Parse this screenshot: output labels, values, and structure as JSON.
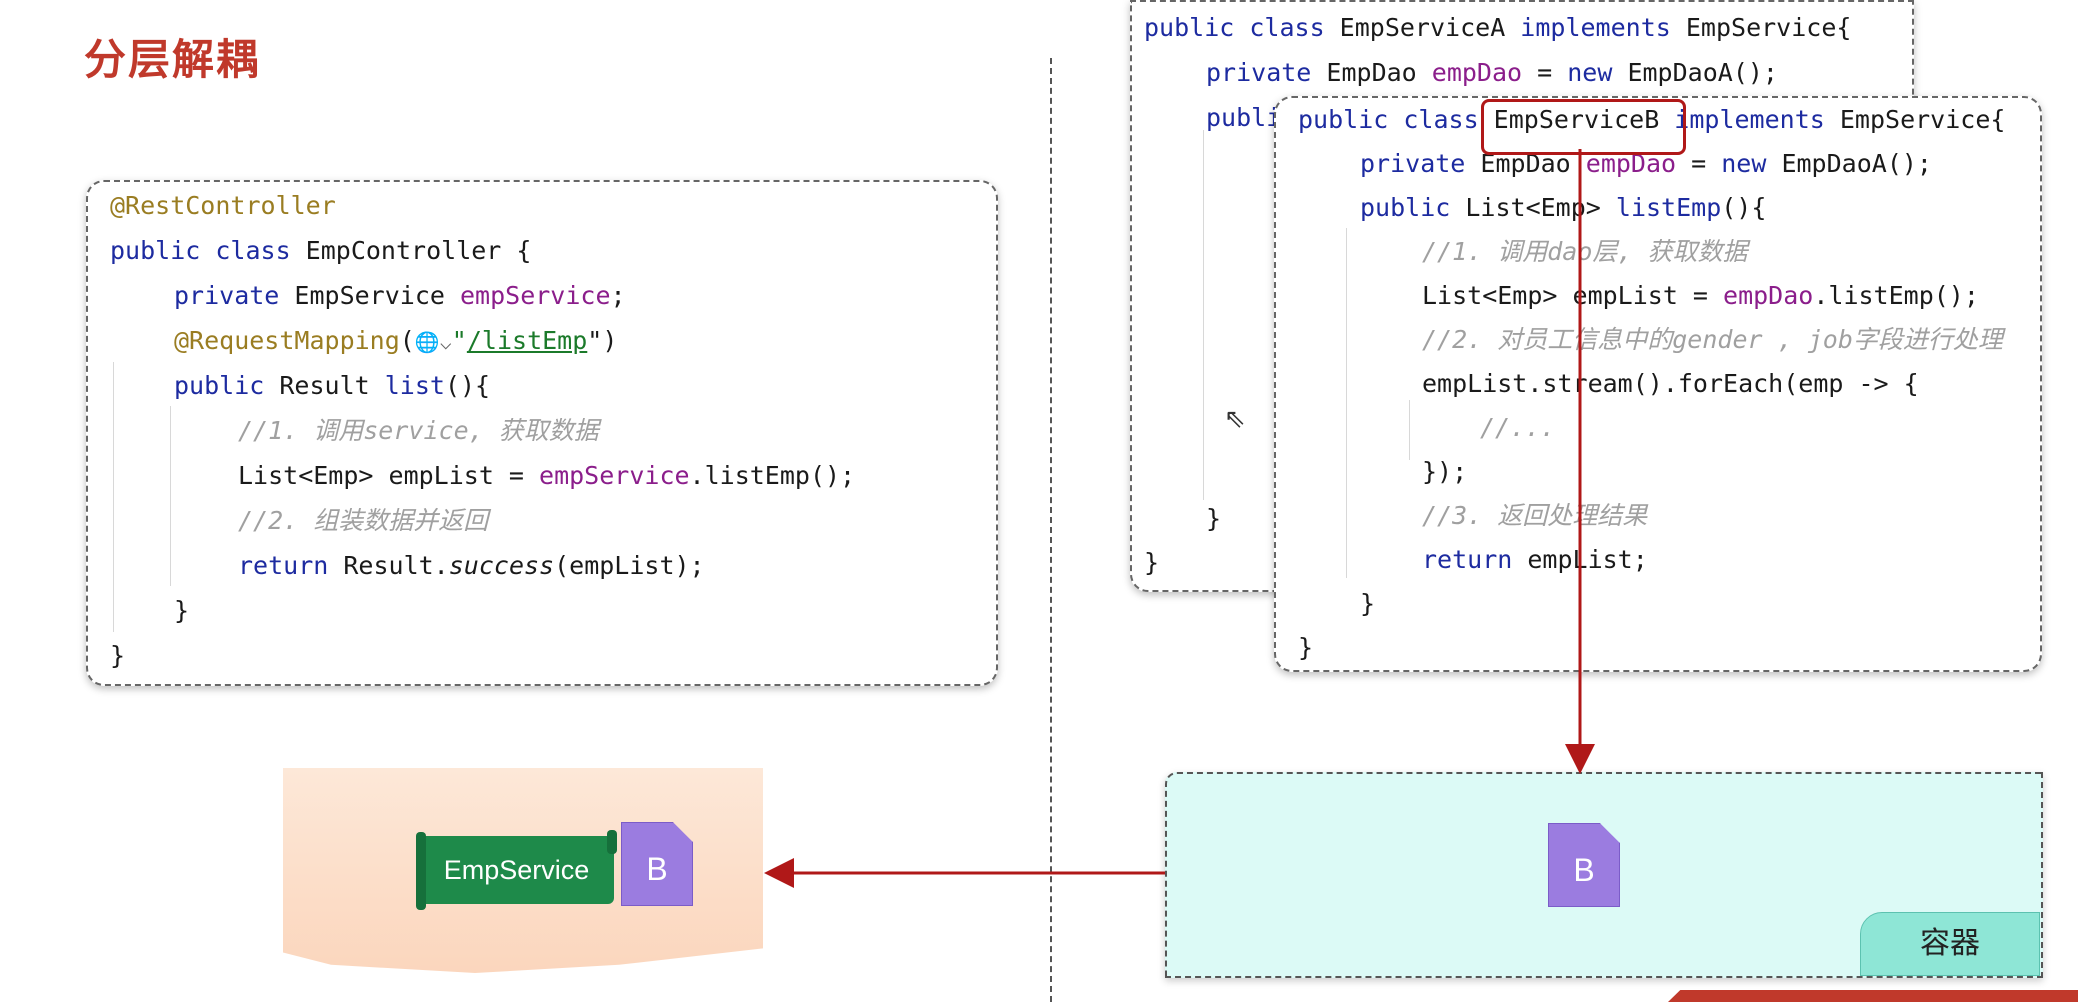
{
  "page": {
    "title": "分层解耦"
  },
  "controller_code": {
    "l1": "@RestController",
    "l2a": "public class",
    "l2b": " EmpController {",
    "l3a": "private",
    "l3b": " EmpService ",
    "l3c": "empService",
    "l3d": ";",
    "l4a": "@RequestMapping",
    "l4b": "(",
    "l4c": "🌐⌵",
    "l4d": "\"",
    "l4e": "/listEmp",
    "l4f": "\")",
    "l5a": "public",
    "l5b": " Result ",
    "l5c": "list",
    "l5d": "(){",
    "l6": "//1. 调用service, 获取数据",
    "l7a": "List<Emp> empList = ",
    "l7b": "empService",
    "l7c": ".listEmp();",
    "l8": "//2. 组装数据并返回",
    "l9a": "return",
    "l9b": " Result.",
    "l9c": "success",
    "l9d": "(empList);",
    "l10": "}",
    "l11": "}"
  },
  "service_a_code": {
    "l1a": "public class",
    "l1b": " EmpServiceA ",
    "l1c": "implements",
    "l1d": " EmpService{",
    "l2a": "private",
    "l2b": " EmpDao ",
    "l2c": "empDao",
    "l2d": " = ",
    "l2e": "new",
    "l2f": " EmpDaoA();",
    "l3": "publi",
    "l4": "}",
    "l5": "}"
  },
  "service_b_code": {
    "l1a": "public class",
    "l1b": " EmpServiceB ",
    "l1c": "implements",
    "l1d": " EmpService{",
    "l2a": "private",
    "l2b": " EmpDao ",
    "l2c": "empDao",
    "l2d": " = ",
    "l2e": "new",
    "l2f": " EmpDaoA();",
    "l3a": "public",
    "l3b": " List<Emp> ",
    "l3c": "listEmp",
    "l3d": "(){",
    "l4": "//1. 调用dao层, 获取数据",
    "l5a": "List<Emp> empList = ",
    "l5b": "empDao",
    "l5c": ".listEmp();",
    "l6": "//2. 对员工信息中的gender , job字段进行处理",
    "l7": "empList.stream().forEach(emp -> {",
    "l8": "//...",
    "l9": "});",
    "l10": "//3. 返回处理结果",
    "l11a": "return",
    "l11b": " empList;",
    "l12": "}",
    "l13": "}"
  },
  "diagram": {
    "injection_tag": "EmpService",
    "bean_letter_left": "B",
    "bean_letter_right": "B",
    "container_label": "容器"
  },
  "colors": {
    "accent_red": "#b01818",
    "title_red": "#c0392b",
    "container_bg": "#dcfaf6",
    "bean_purple": "#9b7ce0",
    "tag_green": "#1e8a4a"
  }
}
